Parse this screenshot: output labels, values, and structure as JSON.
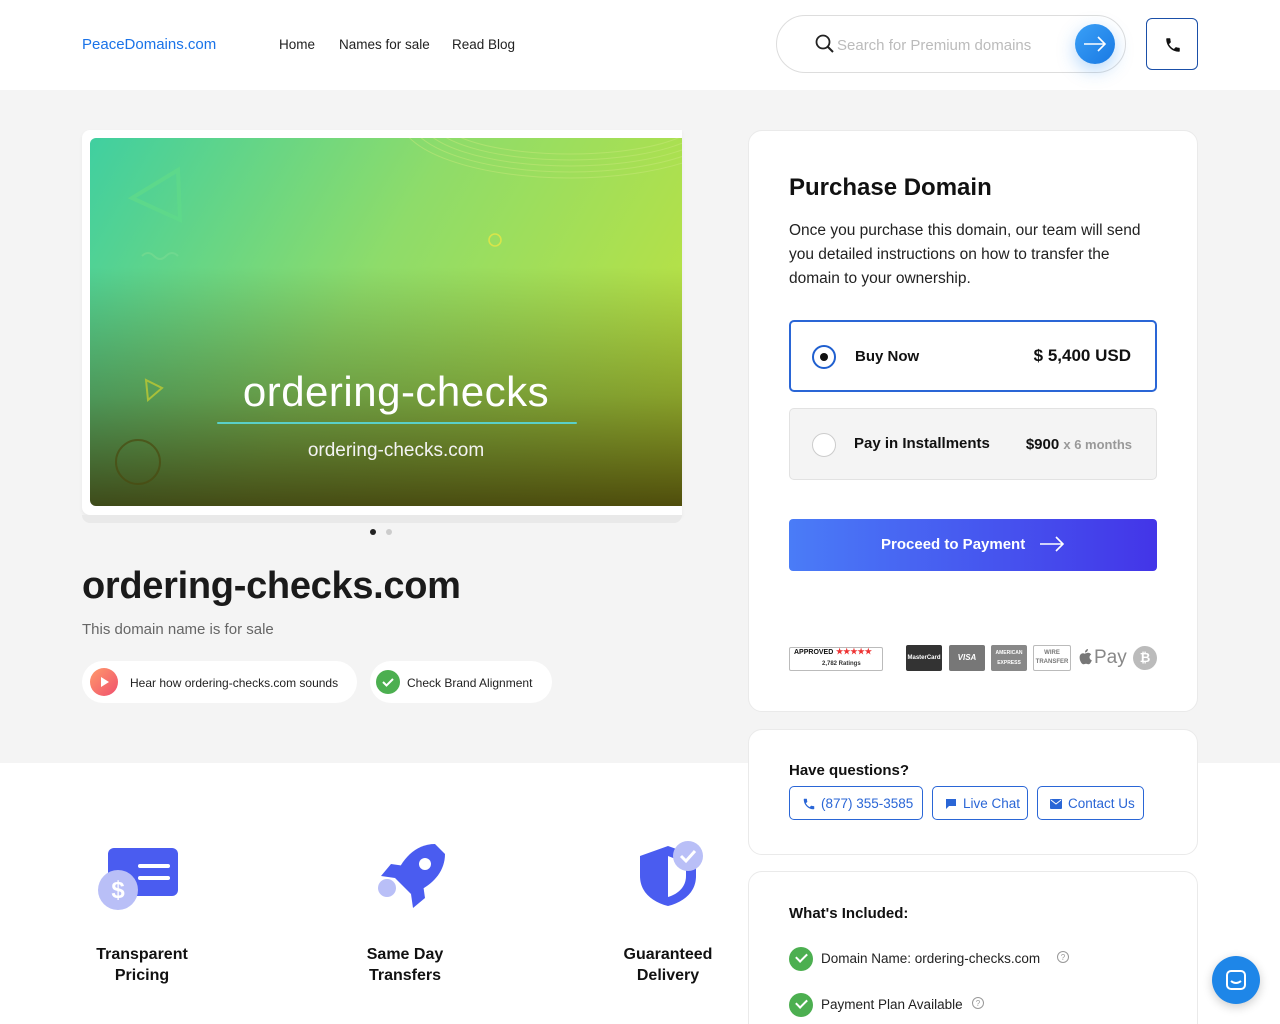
{
  "header": {
    "logo": "PeaceDomains.com",
    "nav": [
      "Home",
      "Names for sale",
      "Read Blog"
    ],
    "search_placeholder": "Search for Premium domains"
  },
  "listing": {
    "image_title": "ordering-checks",
    "image_subtitle": "ordering-checks.com",
    "domain": "ordering-checks.com",
    "tagline": "This domain name is for sale",
    "hear_label": "Hear how ordering-checks.com sounds",
    "brand_label": "Check Brand Alignment",
    "carousel_pages": 2,
    "carousel_active": 1
  },
  "purchase": {
    "title": "Purchase Domain",
    "description": "Once you purchase this domain, our team will send you detailed instructions on how to transfer the domain to your ownership.",
    "buy_now_label": "Buy Now",
    "buy_now_price": "$ 5,400 USD",
    "installments_label": "Pay in Installments",
    "installments_price": "$900",
    "installments_term": "x 6 months",
    "proceed_label": "Proceed to Payment",
    "badge_approved": "APPROVED",
    "badge_stars": "★★★★★",
    "badge_ratings": "2,782 Ratings",
    "pay_methods": [
      "MasterCard",
      "VISA",
      "AMERICAN EXPRESS",
      "WIRE TRANSFER",
      "Pay",
      "₿"
    ]
  },
  "questions": {
    "title": "Have questions?",
    "phone": "(877) 355-3585",
    "chat": "Live Chat",
    "contact": "Contact Us"
  },
  "included": {
    "title": "What's Included:",
    "items": [
      "Domain Name: ordering-checks.com",
      "Payment Plan Available"
    ]
  },
  "features": [
    "Transparent Pricing",
    "Same Day Transfers",
    "Guaranteed Delivery"
  ],
  "colors": {
    "accent": "#2a66d6",
    "link": "#1a73e8",
    "check": "#4caf50",
    "proceed_start": "#4a7cf7",
    "proceed_end": "#4335e8"
  }
}
